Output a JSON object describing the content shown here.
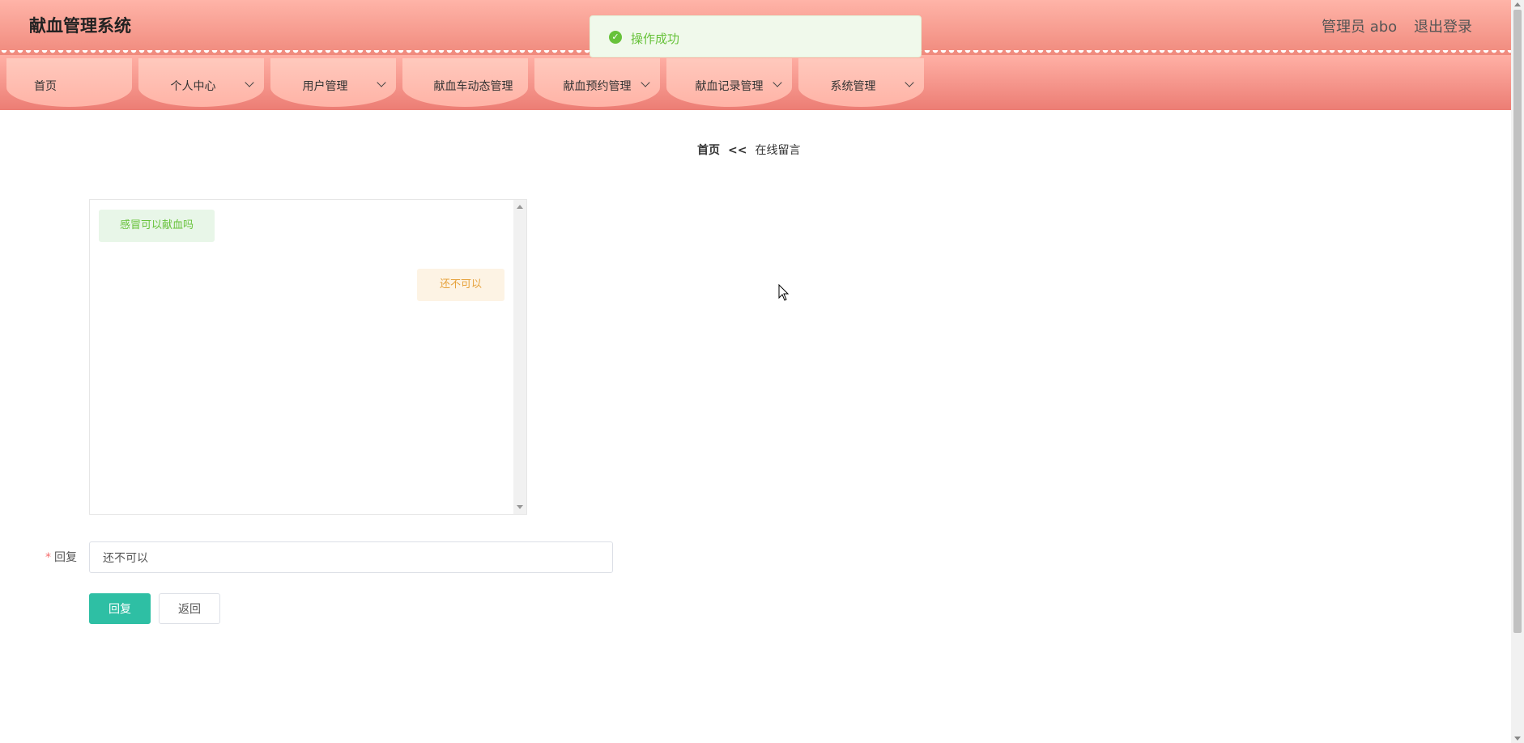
{
  "header": {
    "app_title": "献血管理系统",
    "user_label": "管理员 abo",
    "logout": "退出登录"
  },
  "nav": {
    "items": [
      {
        "label": "首页",
        "has_dropdown": false
      },
      {
        "label": "个人中心",
        "has_dropdown": true
      },
      {
        "label": "用户管理",
        "has_dropdown": true
      },
      {
        "label": "献血车动态管理",
        "has_dropdown": false
      },
      {
        "label": "献血预约管理",
        "has_dropdown": true
      },
      {
        "label": "献血记录管理",
        "has_dropdown": true
      },
      {
        "label": "系统管理",
        "has_dropdown": true
      }
    ]
  },
  "toast": {
    "message": "操作成功",
    "icon": "check-circle-icon",
    "color": "#67c23a"
  },
  "breadcrumb": {
    "home": "首页",
    "separator": "<<",
    "current": "在线留言"
  },
  "chat": {
    "messages": [
      {
        "side": "left",
        "text": "感冒可以献血吗"
      },
      {
        "side": "right",
        "text": "还不可以"
      }
    ]
  },
  "form": {
    "required_mark": "*",
    "reply_label": "回复",
    "reply_value": "还不可以",
    "submit_label": "回复",
    "back_label": "返回"
  },
  "colors": {
    "primary": "#2ebfa4",
    "header_pink": "#f08a7d",
    "success": "#67c23a",
    "warning": "#e6a23c"
  }
}
